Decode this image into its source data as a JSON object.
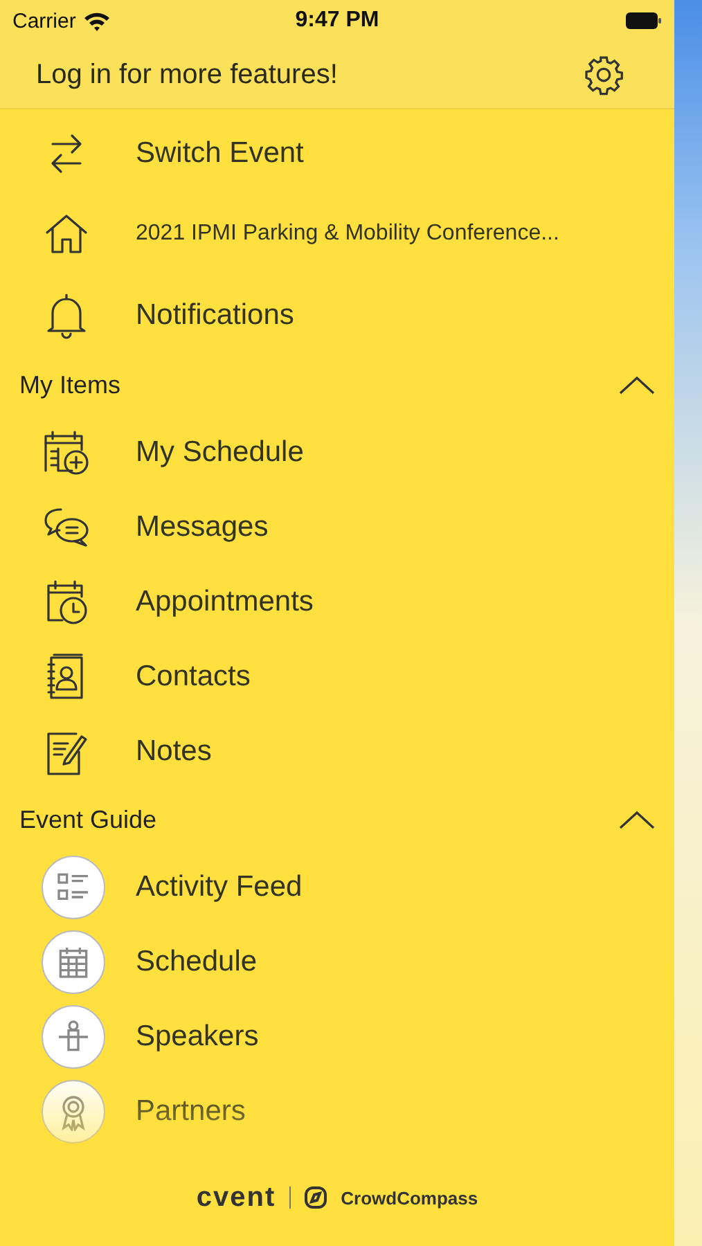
{
  "status_bar": {
    "carrier": "Carrier",
    "time": "9:47 PM"
  },
  "header": {
    "title": "Log in for more features!"
  },
  "top_items": [
    {
      "label": "Switch Event"
    },
    {
      "label": "2021 IPMI Parking & Mobility Conference..."
    },
    {
      "label": "Notifications"
    }
  ],
  "sections": [
    {
      "title": "My Items",
      "expanded": true,
      "items": [
        {
          "label": "My Schedule"
        },
        {
          "label": "Messages"
        },
        {
          "label": "Appointments"
        },
        {
          "label": "Contacts"
        },
        {
          "label": "Notes"
        }
      ]
    },
    {
      "title": "Event Guide",
      "expanded": true,
      "items": [
        {
          "label": "Activity Feed"
        },
        {
          "label": "Schedule"
        },
        {
          "label": "Speakers"
        },
        {
          "label": "Partners"
        }
      ]
    }
  ],
  "footer": {
    "brand": "cvent",
    "partner": "CrowdCompass"
  }
}
